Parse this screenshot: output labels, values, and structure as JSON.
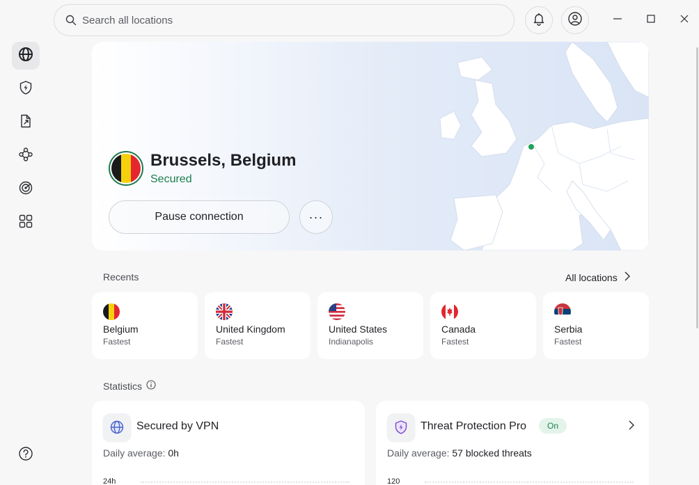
{
  "search": {
    "placeholder": "Search all locations"
  },
  "header": {
    "icons": [
      "search-icon",
      "bell-icon",
      "account-icon",
      "minimize-icon",
      "maximize-icon",
      "close-icon"
    ]
  },
  "sidebar": {
    "items": [
      {
        "icon": "globe-icon",
        "active": true
      },
      {
        "icon": "shield-bolt-icon",
        "active": false
      },
      {
        "icon": "file-share-icon",
        "active": false
      },
      {
        "icon": "meshnet-icon",
        "active": false
      },
      {
        "icon": "radar-icon",
        "active": false
      },
      {
        "icon": "apps-grid-icon",
        "active": false
      }
    ],
    "footer_icon": "help-icon"
  },
  "connection": {
    "location": "Brussels, Belgium",
    "status": "Secured",
    "pause_label": "Pause connection",
    "more_label": "···"
  },
  "recents": {
    "title": "Recents",
    "all_locations": "All locations",
    "items": [
      {
        "country": "Belgium",
        "detail": "Fastest",
        "flag": "belgium-flag"
      },
      {
        "country": "United Kingdom",
        "detail": "Fastest",
        "flag": "uk-flag"
      },
      {
        "country": "United States",
        "detail": "Indianapolis",
        "flag": "us-flag"
      },
      {
        "country": "Canada",
        "detail": "Fastest",
        "flag": "canada-flag"
      },
      {
        "country": "Serbia",
        "detail": "Fastest",
        "flag": "serbia-flag"
      }
    ]
  },
  "statistics": {
    "title": "Statistics",
    "vpn": {
      "title": "Secured by VPN",
      "daily_label": "Daily average:",
      "daily_value": "0h",
      "axis_top": "24h"
    },
    "threat": {
      "title": "Threat Protection Pro",
      "badge": "On",
      "daily_label": "Daily average:",
      "daily_value": "57 blocked threats",
      "axis_top": "120"
    }
  },
  "colors": {
    "accent_green": "#1a7f4b",
    "background": "#f7f7f8",
    "card": "#ffffff"
  }
}
